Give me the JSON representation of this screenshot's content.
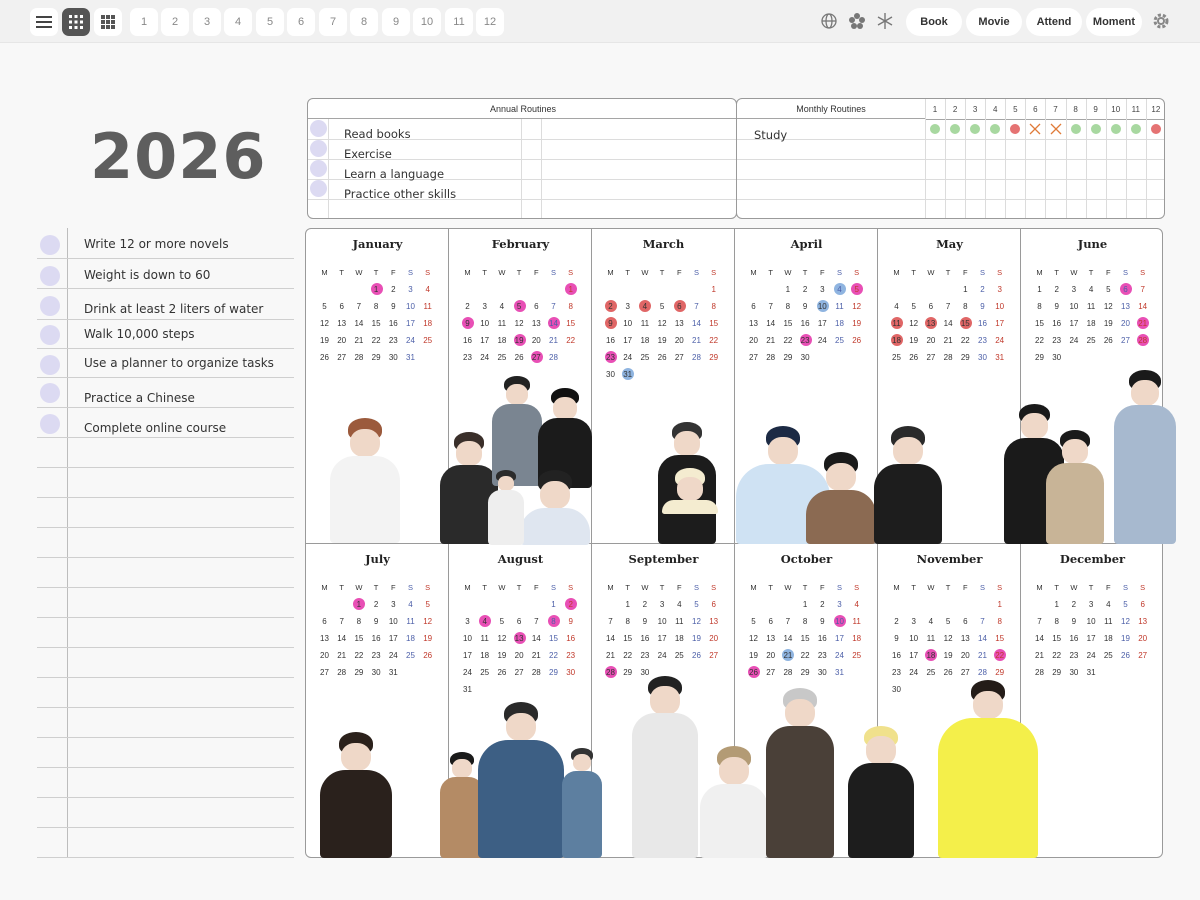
{
  "toolbar": {
    "view_icons": [
      "list-view-icon",
      "grid-view-icon",
      "small-grid-view-icon"
    ],
    "month_tabs": [
      "1",
      "2",
      "3",
      "4",
      "5",
      "6",
      "7",
      "8",
      "9",
      "10",
      "11",
      "12"
    ],
    "right_icons": [
      "globe-icon",
      "flower-icon",
      "snowflake-icon"
    ],
    "pills": [
      "Book",
      "Movie",
      "Attend",
      "Moment"
    ],
    "settings_icon": "gear-icon"
  },
  "year": "2026",
  "goals": [
    "Write 12 or more novels",
    "Weight is down to 60",
    "Drink at least 2 liters of water",
    "Walk 10,000 steps",
    "Use a planner to organize tasks",
    "Practice a Chinese",
    "Complete online course"
  ],
  "annual_routines": {
    "title": "Annual Routines",
    "items": [
      "Read books",
      "Exercise",
      "Learn a language",
      "Practice other skills"
    ]
  },
  "monthly_routines": {
    "title": "Monthly Routines",
    "months": [
      "1",
      "2",
      "3",
      "4",
      "5",
      "6",
      "7",
      "8",
      "9",
      "10",
      "11",
      "12"
    ],
    "items": [
      {
        "label": "Study",
        "status": [
          "green",
          "green",
          "green",
          "green",
          "red",
          "x",
          "x",
          "green",
          "green",
          "green",
          "green",
          "red"
        ]
      }
    ]
  },
  "colors": {
    "green": "#a8d8a0",
    "red": "#e57373",
    "x": "#e07b39",
    "pink": "#e84fb5",
    "coral": "#e06666",
    "blue": "#8fb4e0",
    "goal_dot": "#dcdaf2"
  },
  "weekday_labels": [
    "M",
    "T",
    "W",
    "T",
    "F",
    "S",
    "S"
  ],
  "months": [
    {
      "name": "January",
      "offset": 3,
      "days": 31,
      "highlights": {
        "1": "pink"
      }
    },
    {
      "name": "February",
      "offset": 6,
      "days": 28,
      "highlights": {
        "1": "pink",
        "5": "pink",
        "9": "pink",
        "14": "pink",
        "19": "pink",
        "27": "pink"
      }
    },
    {
      "name": "March",
      "offset": 6,
      "days": 31,
      "highlights": {
        "2": "coral",
        "4": "coral",
        "6": "coral",
        "9": "coral",
        "23": "pink",
        "31": "blue"
      }
    },
    {
      "name": "April",
      "offset": 2,
      "days": 30,
      "highlights": {
        "4": "blue",
        "5": "pink",
        "10": "blue",
        "23": "pink"
      }
    },
    {
      "name": "May",
      "offset": 4,
      "days": 31,
      "highlights": {
        "11": "coral",
        "13": "coral",
        "15": "coral",
        "18": "coral"
      }
    },
    {
      "name": "June",
      "offset": 0,
      "days": 30,
      "highlights": {
        "6": "pink",
        "21": "pink",
        "28": "pink"
      }
    },
    {
      "name": "July",
      "offset": 2,
      "days": 31,
      "highlights": {
        "1": "pink"
      }
    },
    {
      "name": "August",
      "offset": 5,
      "days": 31,
      "highlights": {
        "2": "pink",
        "4": "pink",
        "8": "pink",
        "13": "pink"
      }
    },
    {
      "name": "September",
      "offset": 1,
      "days": 30,
      "highlights": {
        "28": "pink"
      }
    },
    {
      "name": "October",
      "offset": 3,
      "days": 31,
      "highlights": {
        "10": "pink",
        "21": "blue",
        "26": "pink"
      }
    },
    {
      "name": "November",
      "offset": 6,
      "days": 30,
      "highlights": {
        "18": "pink",
        "22": "pink"
      }
    },
    {
      "name": "December",
      "offset": 1,
      "days": 31,
      "highlights": {}
    }
  ]
}
